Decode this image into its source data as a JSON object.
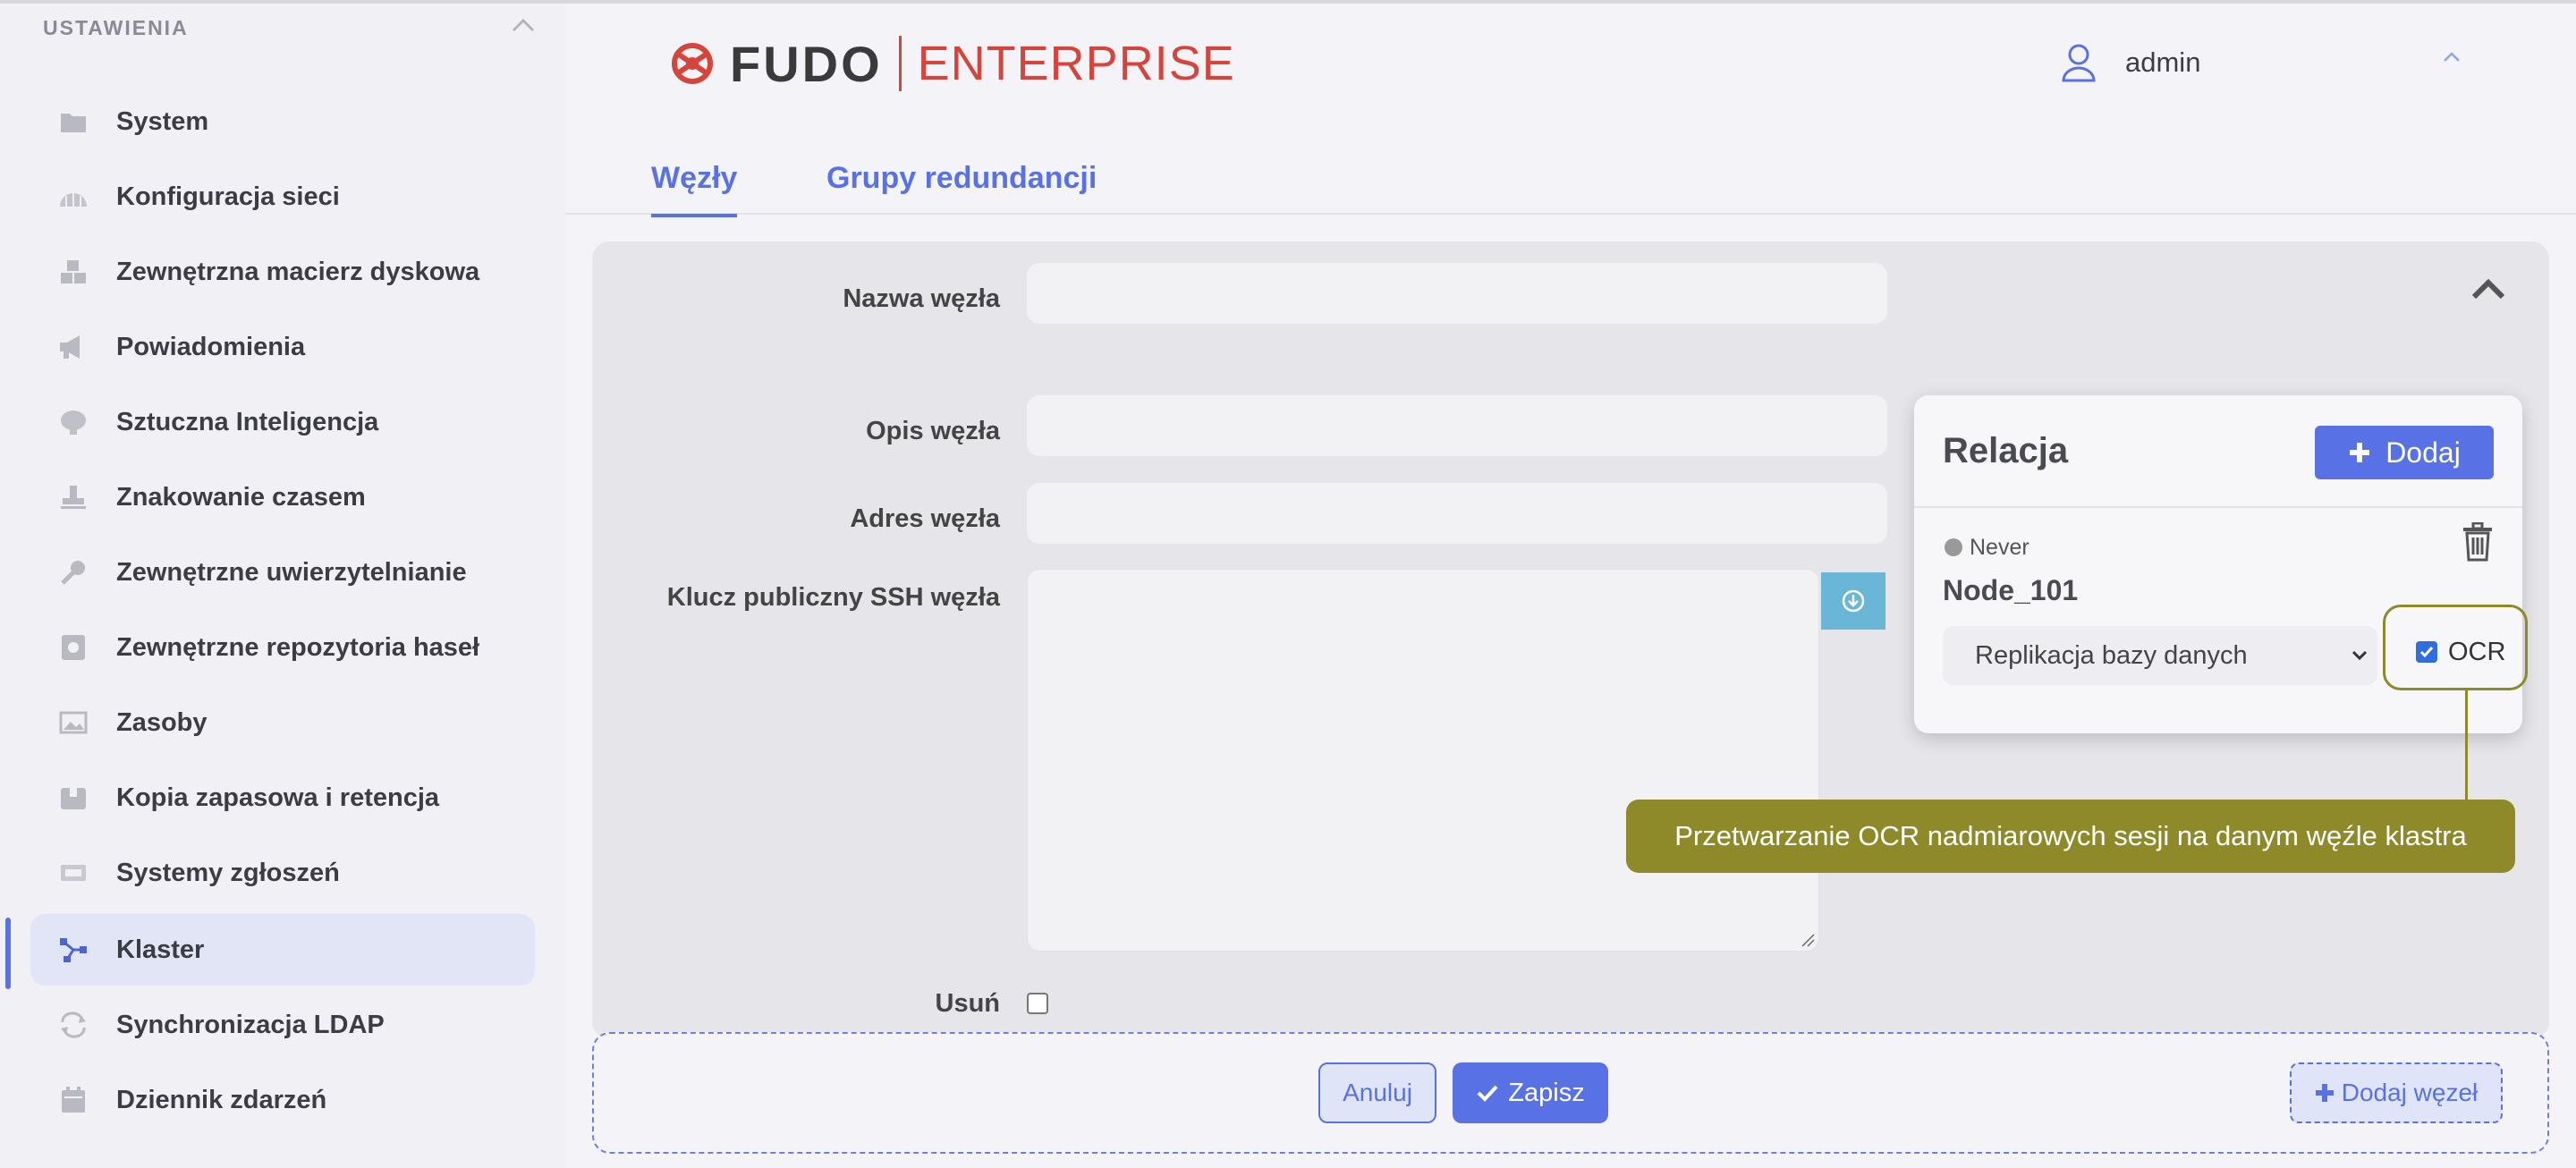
{
  "sidebar": {
    "header": "USTAWIENIA",
    "items": [
      {
        "label": "System",
        "icon": "folder-icon"
      },
      {
        "label": "Konfiguracja sieci",
        "icon": "network-icon"
      },
      {
        "label": "Zewnętrzna macierz dyskowa",
        "icon": "disk-array-icon"
      },
      {
        "label": "Powiadomienia",
        "icon": "megaphone-icon"
      },
      {
        "label": "Sztuczna Inteligencja",
        "icon": "brain-icon"
      },
      {
        "label": "Znakowanie czasem",
        "icon": "stamp-icon"
      },
      {
        "label": "Zewnętrzne uwierzytelnianie",
        "icon": "key-icon"
      },
      {
        "label": "Zewnętrzne repozytoria haseł",
        "icon": "vault-icon"
      },
      {
        "label": "Zasoby",
        "icon": "image-icon"
      },
      {
        "label": "Kopia zapasowa i retencja",
        "icon": "archive-icon"
      },
      {
        "label": "Systemy zgłoszeń",
        "icon": "ticket-icon"
      },
      {
        "label": "Klaster",
        "icon": "cluster-icon",
        "active": true
      },
      {
        "label": "Synchronizacja LDAP",
        "icon": "sync-icon"
      },
      {
        "label": "Dziennik zdarzeń",
        "icon": "calendar-icon"
      }
    ]
  },
  "header": {
    "logo_brand": "FUDO",
    "logo_edition": "ENTERPRISE",
    "user": "admin"
  },
  "tabs": [
    {
      "label": "Węzły",
      "active": true
    },
    {
      "label": "Grupy redundancji",
      "active": false
    }
  ],
  "form": {
    "name_label": "Nazwa węzła",
    "name_value": "",
    "description_label": "Opis węzła",
    "description_value": "",
    "address_label": "Adres węzła",
    "address_value": "",
    "ssh_label": "Klucz publiczny SSH węzła",
    "ssh_value": "",
    "delete_label": "Usuń",
    "delete_checked": false
  },
  "relation": {
    "title": "Relacja",
    "add_label": "Dodaj",
    "status": "Never",
    "node": "Node_101",
    "type_selected": "Replikacja bazy danych",
    "ocr_label": "OCR",
    "ocr_checked": true
  },
  "callout": "Przetwarzanie OCR nadmiarowych sesji na danym węźle klastra",
  "actions": {
    "cancel": "Anuluj",
    "save": "Zapisz",
    "add_node": "Dodaj węzeł"
  },
  "colors": {
    "accent": "#5872e6",
    "brand_red": "#d6453c",
    "callout": "#8e8a2a",
    "ssh_button": "#6ab6d6"
  }
}
